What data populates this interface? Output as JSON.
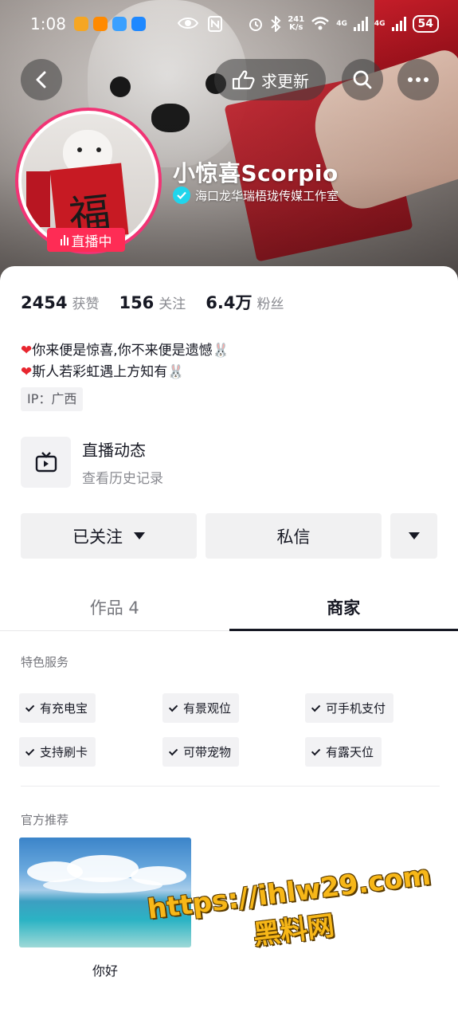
{
  "status_bar": {
    "time": "1:08",
    "net_speed_value": "241",
    "net_speed_unit": "K/s",
    "signal1": "4G",
    "signal2": "4G",
    "battery": "54"
  },
  "header": {
    "update_request_label": "求更新",
    "username": "小惊喜Scorpio",
    "verified_org": "海口龙华瑞梧珑传媒工作室",
    "live_badge": "直播中",
    "cover_char": "福"
  },
  "stats": [
    {
      "value": "2454",
      "label": "获赞"
    },
    {
      "value": "156",
      "label": "关注"
    },
    {
      "value": "6.4万",
      "label": "粉丝"
    }
  ],
  "bio": {
    "line1": "你来便是惊喜,你不来便是遗憾",
    "line2": "斯人若彩虹遇上方知有",
    "ip": "IP：广西"
  },
  "live_history": {
    "title": "直播动态",
    "subtitle": "查看历史记录"
  },
  "actions": {
    "following_label": "已关注",
    "message_label": "私信"
  },
  "tabs": [
    {
      "label": "作品 4",
      "active": false
    },
    {
      "label": "商家",
      "active": true
    }
  ],
  "merchant": {
    "services_title": "特色服务",
    "services": [
      "有充电宝",
      "有景观位",
      "可手机支付",
      "支持刷卡",
      "可带宠物",
      "有露天位"
    ],
    "recommend_title": "官方推荐",
    "recommend_item": "你好"
  },
  "watermark": {
    "line1": "https://ihlw29.com",
    "line2": "黑料网"
  },
  "colors": {
    "live_pink": "#fe2c55",
    "verify_blue": "#20d5ec",
    "text_primary": "#161823",
    "text_secondary": "#8a8b91",
    "watermark_yellow": "#f7b718"
  }
}
